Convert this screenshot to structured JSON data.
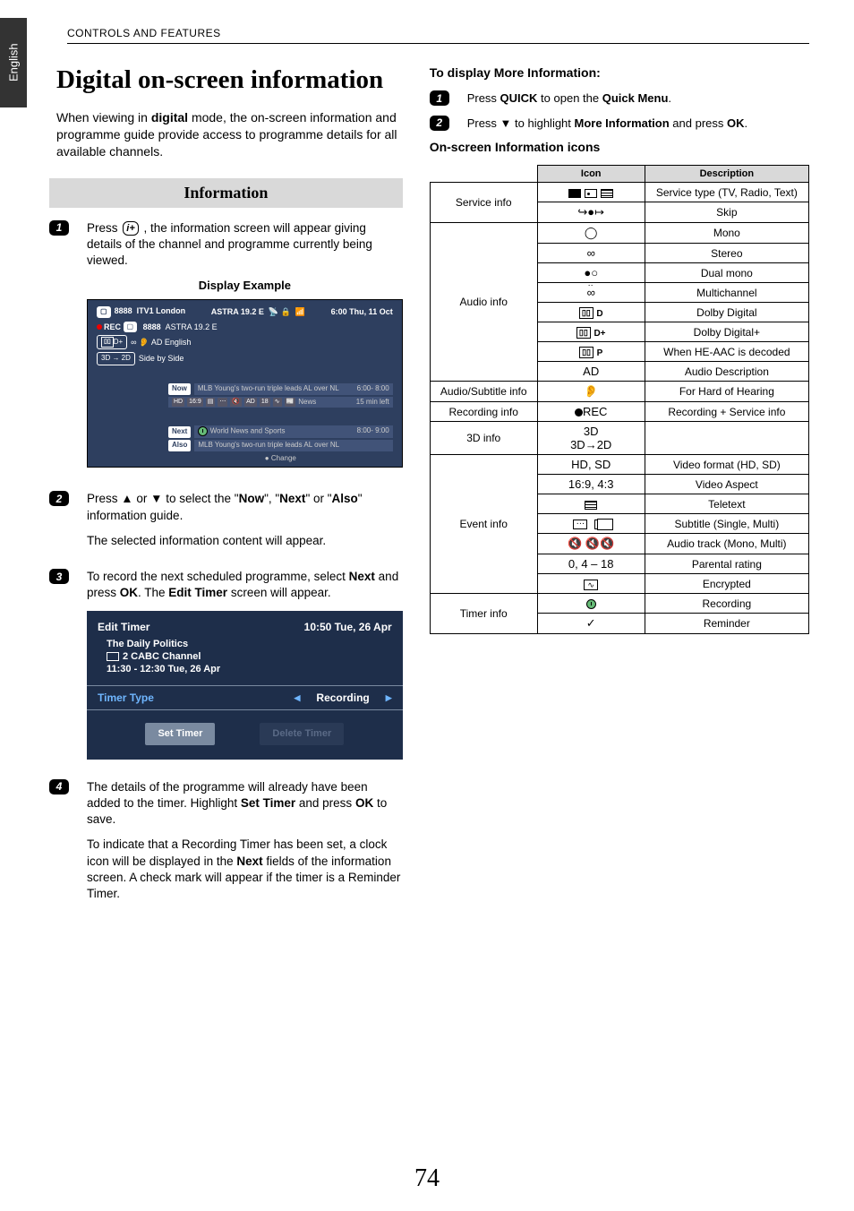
{
  "side_tab": "English",
  "header": "CONTROLS AND FEATURES",
  "title": "Digital on-screen information",
  "intro_pre": "When viewing in ",
  "intro_bold": "digital",
  "intro_post": " mode, the on-screen information and programme guide provide access to programme details for all available channels.",
  "section_head": "Information",
  "step1_a": "Press ",
  "step1_icon": "i+",
  "step1_b": " , the information screen will appear giving details of the channel and programme currently being viewed.",
  "display_caption": "Display Example",
  "disp": {
    "num1": "8888",
    "name1": "ITV1 London",
    "sat": "ASTRA 19.2  E",
    "clock": "6:00 Thu, 11 Oct",
    "rec": "REC",
    "num2": "8888",
    "sat2": "ASTRA 19.2  E",
    "dd": "D+",
    "ad": "AD English",
    "threeD": "3D → 2D",
    "sbs": "Side by Side",
    "now": "Now",
    "now_text": "MLB Young's two-run triple leads AL over NL",
    "now_time": "6:00- 8:00",
    "icons_row": "HD  16:9  AD  18  News",
    "time_left": "15 min left",
    "next": "Next",
    "next_text": "World News and Sports",
    "next_time": "8:00- 9:00",
    "also": "Also",
    "also_text": "MLB Young's two-run triple leads AL over NL",
    "change": "Change"
  },
  "step2_a": "Press ▲ or ▼ to select the \"",
  "step2_now": "Now",
  "step2_mid1": "\", \"",
  "step2_next": "Next",
  "step2_mid2": "\" or \"",
  "step2_also": "Also",
  "step2_b": "\" information guide.",
  "step2_c": "The selected information content will appear.",
  "step3_a": "To record the next scheduled programme, select ",
  "step3_next": "Next",
  "step3_b": " and press ",
  "step3_ok": "OK",
  "step3_c": ". The ",
  "step3_et": "Edit Timer",
  "step3_d": " screen will appear.",
  "et": {
    "title": "Edit Timer",
    "time": "10:50 Tue, 26 Apr",
    "prog": "The Daily Politics",
    "chan": "2 CABC Channel",
    "sched": "11:30 - 12:30 Tue, 26 Apr",
    "type_label": "Timer Type",
    "type_val": "Recording",
    "set": "Set Timer",
    "del": "Delete Timer"
  },
  "step4_a": "The details of the programme will already have been added to the timer. Highlight ",
  "step4_set": "Set Timer",
  "step4_b": " and press ",
  "step4_ok": "OK",
  "step4_c": " to save.",
  "step4_d": "To indicate that a Recording Timer has been set, a clock icon will be displayed in the ",
  "step4_next": "Next",
  "step4_e": " fields of the information screen. A check mark will appear if the timer is a Reminder Timer.",
  "right": {
    "head1": "To display More Information:",
    "r1_a": "Press ",
    "r1_q": "QUICK",
    "r1_b": " to open the ",
    "r1_qm": "Quick Menu",
    "r1_c": ".",
    "r2_a": "Press ▼ to highlight ",
    "r2_mi": "More Information",
    "r2_b": " and press ",
    "r2_ok": "OK",
    "r2_c": ".",
    "head2": "On-screen Information icons"
  },
  "table": {
    "h_icon": "Icon",
    "h_desc": "Description",
    "rows": [
      {
        "cat": "Service info",
        "span": 2,
        "icon": "svc",
        "desc": "Service type (TV, Radio, Text)"
      },
      {
        "icon": "skip",
        "desc": "Skip"
      },
      {
        "cat": "Audio info",
        "span": 7,
        "icon": "mono",
        "desc": "Mono"
      },
      {
        "icon": "stereo",
        "desc": "Stereo"
      },
      {
        "icon": "dual",
        "desc": "Dual mono"
      },
      {
        "icon": "multi",
        "desc": "Multichannel"
      },
      {
        "icon": "dd",
        "desc": "Dolby Digital"
      },
      {
        "icon": "ddp",
        "desc": "Dolby Digital+"
      },
      {
        "icon": "ddpulse",
        "desc": "When HE-AAC is decoded"
      },
      {
        "icon_text": "AD",
        "desc": "Audio Description",
        "nocat_pad": true
      },
      {
        "cat": "Audio/Subtitle info",
        "span": 1,
        "icon": "ear",
        "desc": "For Hard of Hearing"
      },
      {
        "cat": "Recording info",
        "span": 1,
        "icon": "rec",
        "desc": "Recording + Service info"
      },
      {
        "cat": "3D info",
        "span": 1,
        "icon_text": "3D\n3D→2D",
        "desc": ""
      },
      {
        "cat": "Event info",
        "span": 7,
        "icon_text": "HD, SD",
        "desc": "Video format (HD, SD)"
      },
      {
        "icon_text": "16:9, 4:3",
        "desc": "Video Aspect"
      },
      {
        "icon": "ttx",
        "desc": "Teletext"
      },
      {
        "icon": "subt",
        "desc": "Subtitle (Single, Multi)"
      },
      {
        "icon": "audio_track",
        "desc": "Audio track (Mono, Multi)"
      },
      {
        "icon_text": "0, 4 – 18",
        "desc": "Parental rating"
      },
      {
        "icon": "enc",
        "desc": "Encrypted"
      },
      {
        "cat": "Timer info",
        "span": 2,
        "icon": "clock",
        "desc": "Recording"
      },
      {
        "icon": "check",
        "desc": "Reminder"
      }
    ]
  },
  "page_num": "74"
}
